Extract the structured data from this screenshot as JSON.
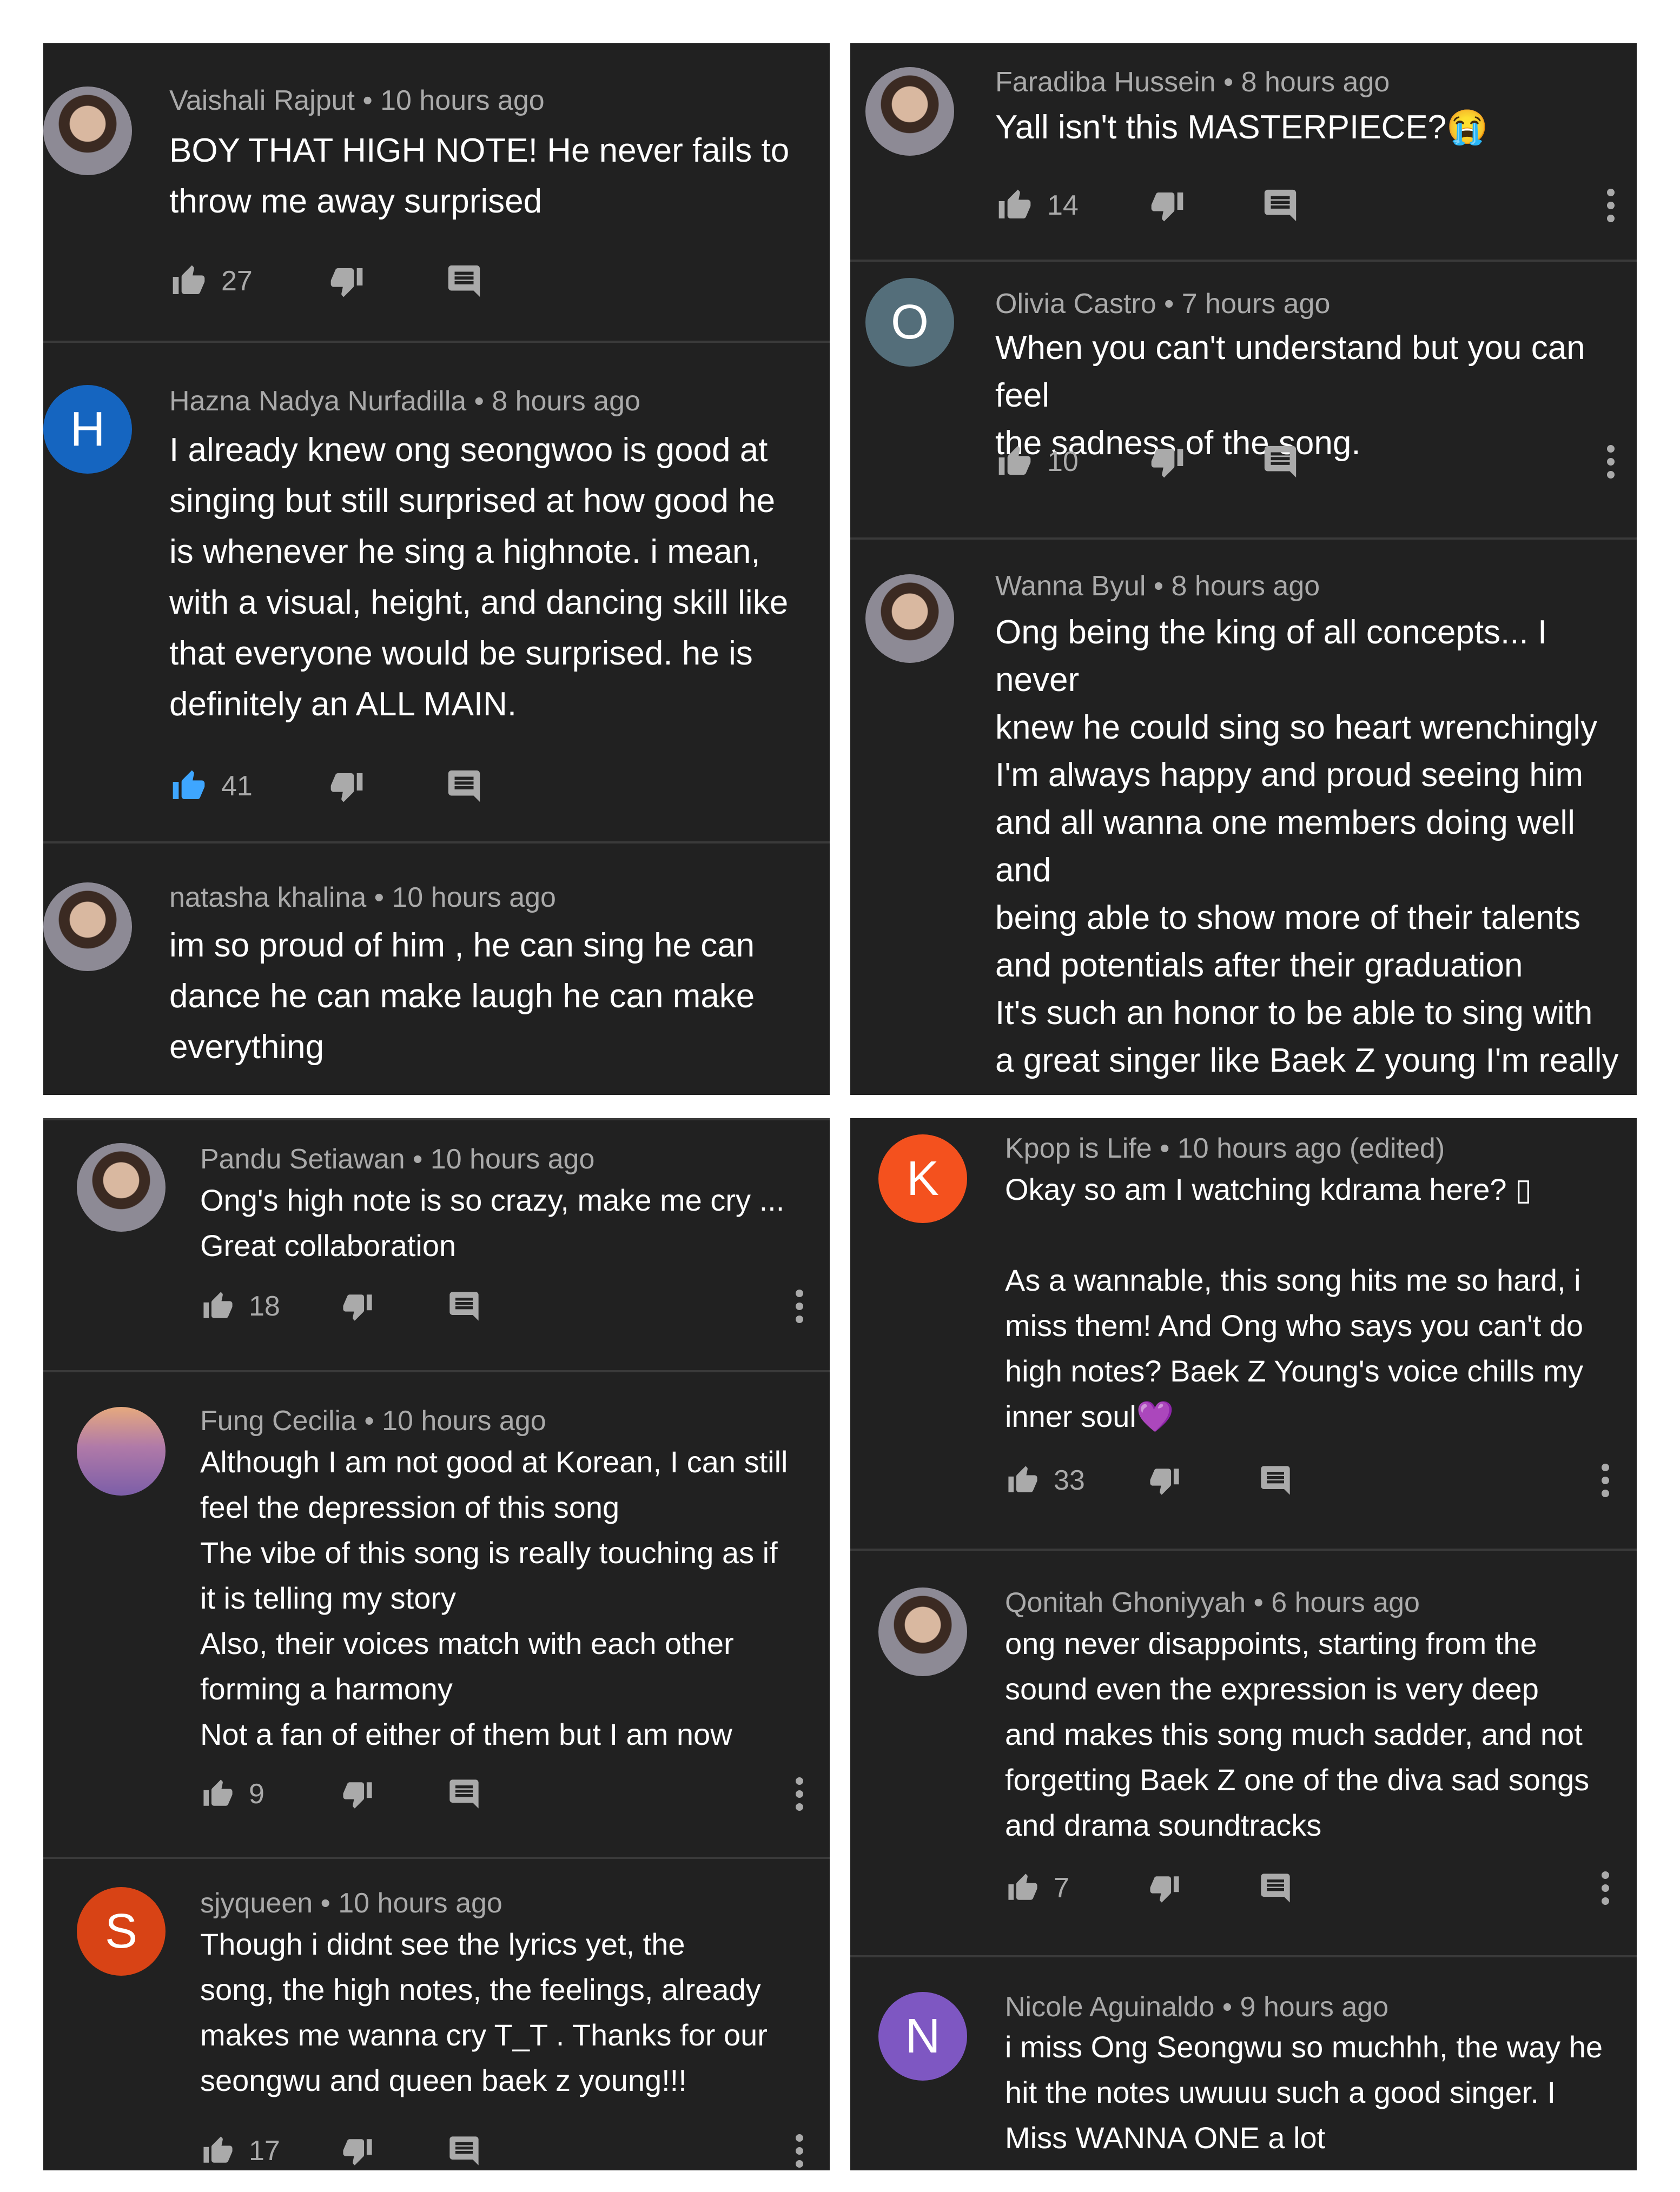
{
  "colors": {
    "background": "#212121",
    "text": "#ffffff",
    "meta": "#aaaaaa",
    "icon": "#aaaaaa",
    "like_active": "#3ea6ff",
    "divider": "#3a3a3a",
    "avatar_h": "#1565c0",
    "avatar_o": "#546e7a",
    "avatar_s": "#d84315",
    "avatar_k": "#f4511e",
    "avatar_n": "#7e57c2"
  },
  "panels": [
    {
      "comments": [
        {
          "author_line": "Vaishali Rajput • 10 hours ago",
          "text": "BOY THAT HIGH NOTE! He never fails to\nthrow me away surprised",
          "likes": "27",
          "avatar": "photo"
        },
        {
          "author_line": "Hazna Nadya Nurfadilla • 8 hours ago",
          "text": "I already knew ong seongwoo is good at\nsinging but still surprised at how good he\nis whenever he sing a highnote. i mean,\nwith a visual, height, and dancing skill like\nthat everyone would be surprised. he is\ndefinitely an ALL MAIN.",
          "likes": "41",
          "avatar_letter": "H",
          "liked": true
        },
        {
          "author_line": "natasha khalina • 10 hours ago",
          "text": "im so proud of him , he can sing he can\ndance he can make laugh he can make\neverything",
          "avatar": "photo"
        }
      ]
    },
    {
      "comments": [
        {
          "author_line": "Faradiba Hussein • 8 hours ago",
          "text": "Yall isn't this MASTERPIECE?😭",
          "likes": "14",
          "avatar": "photo"
        },
        {
          "author_line": "Olivia Castro • 7 hours ago",
          "text": "When you can't understand but you can feel\nthe sadness of the song.",
          "likes": "10",
          "avatar_letter": "O"
        },
        {
          "author_line": "Wanna Byul • 8 hours ago",
          "text": "Ong being the king of all concepts... I never\nknew he could sing so heart wrenchingly\nI'm always happy and proud seeing him\nand all wanna one members doing well and\nbeing able to show more of their talents\nand potentials after their graduation\nIt's such an honor to be able to sing with\na great singer like Baek Z young I'm really\nproud of him and his singing, he did soo\nwell 💕",
          "avatar": "photo"
        }
      ]
    },
    {
      "comments": [
        {
          "author_line": "Pandu Setiawan • 10 hours ago",
          "text": "Ong's high note is so crazy, make me cry ...\nGreat collaboration",
          "likes": "18",
          "avatar": "photo"
        },
        {
          "author_line": "Fung Cecilia • 10 hours ago",
          "text": "Although I am not good at Korean, I can still\nfeel the depression of this song\nThe vibe of this song is really touching as if\nit is telling my story\nAlso, their voices match with each other\nforming a harmony\nNot a fan of either of them but I am now",
          "likes": "9",
          "avatar": "photo"
        },
        {
          "author_line": "sjyqueen • 10 hours ago",
          "text": "Though i didnt see the lyrics yet, the\nsong, the high notes, the feelings, already\nmakes me wanna cry T_T . Thanks for our\nseongwu and queen baek z young!!!",
          "likes": "17",
          "avatar_letter": "S"
        }
      ]
    },
    {
      "comments": [
        {
          "author_line": "Kpop is Life • 10 hours ago (edited)",
          "text": "Okay so am I watching kdrama here? ▯\n\nAs a wannable, this song hits me so hard, i\nmiss them! And Ong who says you can't do\nhigh notes? Baek Z Young's voice chills my\ninner soul💜",
          "likes": "33",
          "avatar_letter": "K"
        },
        {
          "author_line": "Qonitah Ghoniyyah • 6 hours ago",
          "text": "ong never disappoints, starting from the\nsound even the expression is very deep\nand makes this song much sadder, and not\nforgetting Baek Z one of the diva sad songs\nand drama soundtracks",
          "likes": "7",
          "avatar": "photo"
        },
        {
          "author_line": "Nicole Aguinaldo • 9 hours ago",
          "text": "i miss Ong Seongwu so muchhh, the way he\nhit  the notes uwuuu such a good singer. I\nMiss WANNA ONE a lot",
          "avatar_letter": "N"
        }
      ]
    }
  ]
}
